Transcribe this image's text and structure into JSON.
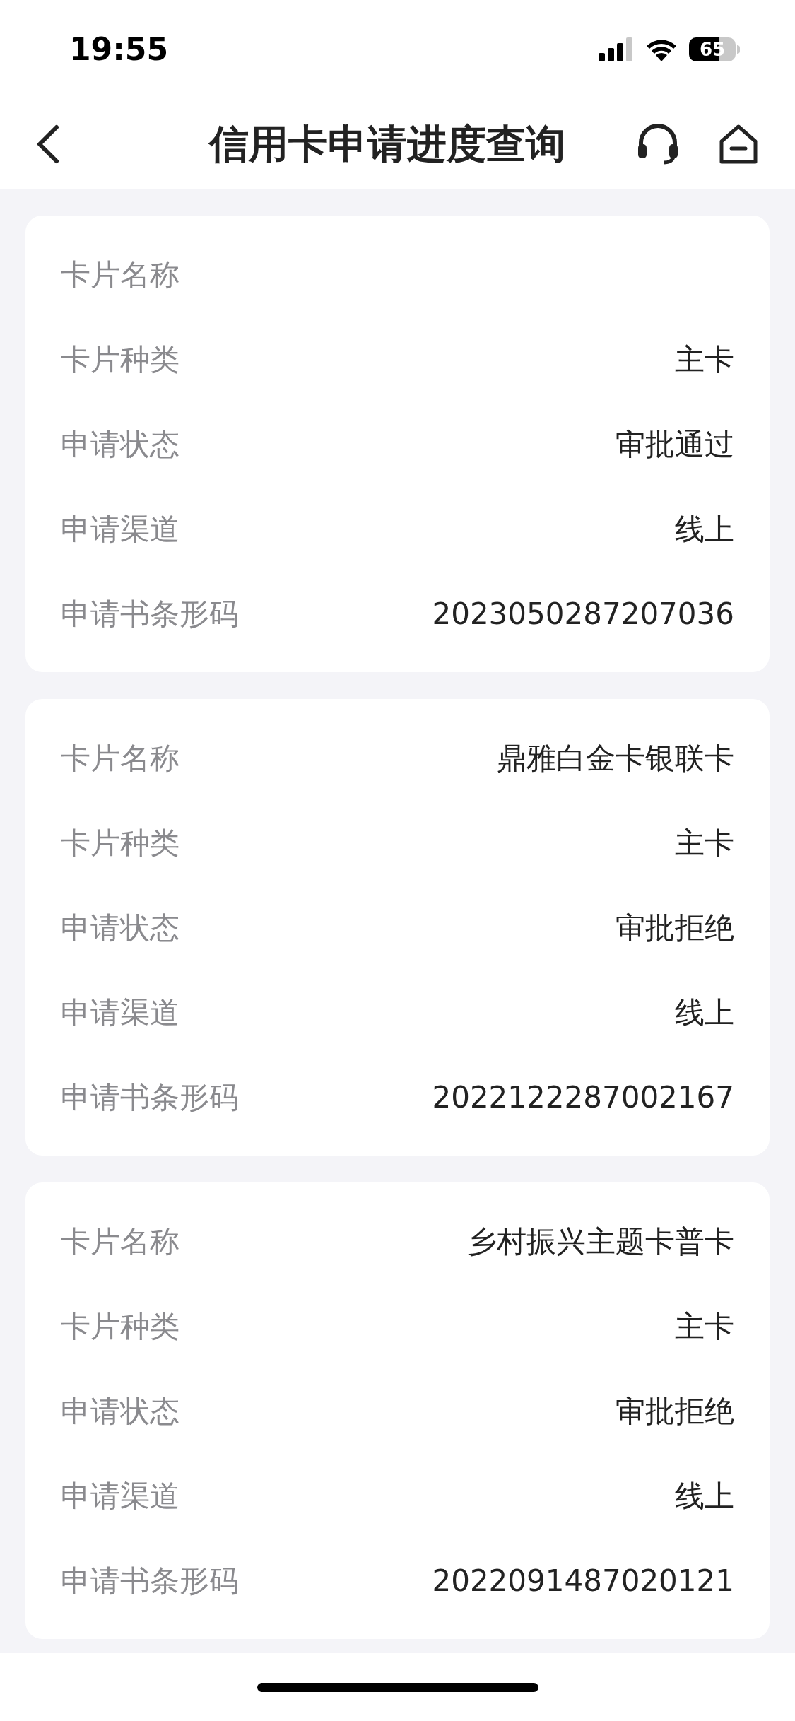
{
  "status_bar": {
    "time": "19:55",
    "battery": "65"
  },
  "header": {
    "title": "信用卡申请进度查询"
  },
  "cards": [
    {
      "rows": [
        {
          "label": "卡片名称"
        },
        {
          "label": "卡片种类",
          "value": "主卡"
        },
        {
          "label": "申请状态",
          "value": "审批通过"
        },
        {
          "label": "申请渠道",
          "value": "线上"
        },
        {
          "label": "申请书条形码",
          "value": "2023050287207036"
        }
      ]
    },
    {
      "rows": [
        {
          "label": "卡片名称",
          "value": "鼎雅白金卡银联卡"
        },
        {
          "label": "卡片种类",
          "value": "主卡"
        },
        {
          "label": "申请状态",
          "value": "审批拒绝"
        },
        {
          "label": "申请渠道",
          "value": "线上"
        },
        {
          "label": "申请书条形码",
          "value": "2022122287002167"
        }
      ]
    },
    {
      "rows": [
        {
          "label": "卡片名称",
          "value": "乡村振兴主题卡普卡"
        },
        {
          "label": "卡片种类",
          "value": "主卡"
        },
        {
          "label": "申请状态",
          "value": "审批拒绝"
        },
        {
          "label": "申请渠道",
          "value": "线上"
        },
        {
          "label": "申请书条形码",
          "value": "2022091487020121"
        }
      ]
    }
  ]
}
